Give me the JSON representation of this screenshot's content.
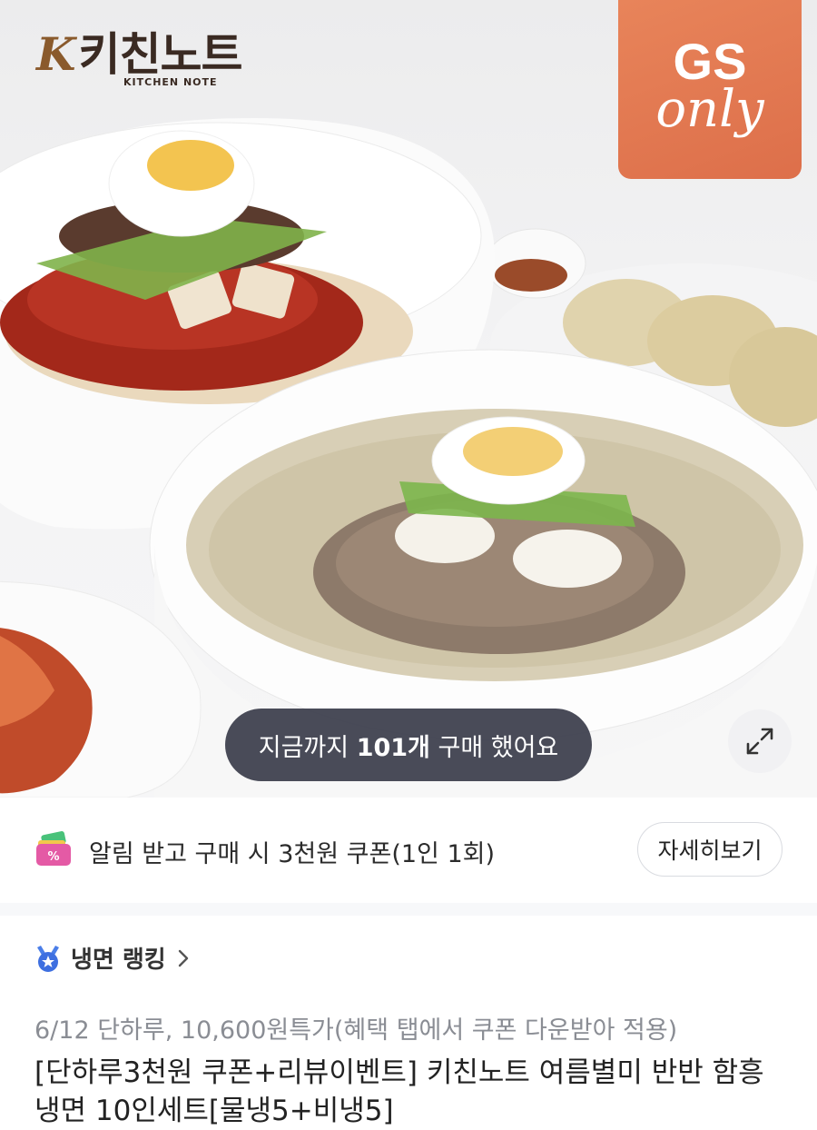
{
  "brand": {
    "name": "키친노트",
    "subtitle": "KITCHEN NOTE",
    "k_mark": "K"
  },
  "badge": {
    "line1": "GS",
    "line2": "only"
  },
  "purchase": {
    "prefix": "지금까지 ",
    "count": "101개",
    "suffix": " 구매 했어요"
  },
  "icons": {
    "expand": "expand-icon",
    "coupon": "coupon-wallet-icon",
    "ranking": "medal-icon",
    "chevron": "chevron-right-icon"
  },
  "coupon": {
    "text": "알림 받고 구매 시 3천원 쿠폰(1인 1회)",
    "detail_button": "자세히보기"
  },
  "ranking": {
    "label": "냉면 랭킹"
  },
  "product": {
    "promo": "6/12 단하루, 10,600원특가(혜택 탭에서 쿠폰 다운받아 적용)",
    "title": "[단하루3천원 쿠폰+리뷰이벤트] 키친노트 여름별미 반반 함흥냉면 10인세트[물냉5+비냉5]"
  },
  "colors": {
    "badge_bg": "#e07a52",
    "pill_bg": "#3a3c4a",
    "brand_text": "#3a2a22",
    "promo_text": "#8a8d94"
  }
}
